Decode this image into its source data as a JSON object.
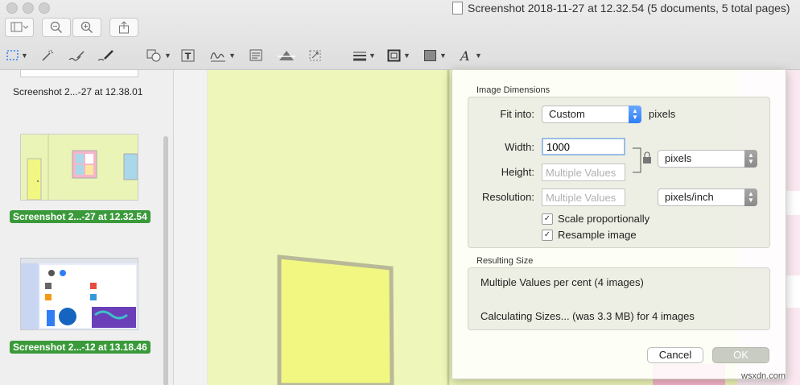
{
  "window": {
    "title": "Screenshot 2018-11-27 at 12.32.54 (5 documents, 5 total pages)"
  },
  "toolbar": {
    "sidebar_icon": "sidebar-toggle-icon",
    "zoom_out_icon": "zoom-out-icon",
    "zoom_in_icon": "zoom-in-icon",
    "share_icon": "share-icon"
  },
  "markup_tools": [
    "rect-select-icon",
    "instant-alpha-icon",
    "sketch-icon",
    "draw-icon",
    "shapes-icon",
    "text-icon",
    "sign-icon",
    "note-icon",
    "adjust-color-icon",
    "adjust-size-icon",
    "line-style-icon",
    "border-color-icon",
    "fill-color-icon",
    "text-style-icon"
  ],
  "sidebar": {
    "items": [
      {
        "label": "Screenshot 2...-27 at 12.38.01",
        "selected": false
      },
      {
        "label": "Screenshot 2...-27 at 12.32.54",
        "selected": true
      },
      {
        "label": "Screenshot 2...-12 at 13.18.46",
        "selected": true
      }
    ]
  },
  "dialog": {
    "image_dimensions_label": "Image Dimensions",
    "fit_into_label": "Fit into:",
    "fit_into_value": "Custom",
    "fit_into_unit": "pixels",
    "width_label": "Width:",
    "width_value": "1000",
    "height_label": "Height:",
    "height_placeholder": "Multiple Values",
    "resolution_label": "Resolution:",
    "resolution_placeholder": "Multiple Values",
    "size_unit": "pixels",
    "resolution_unit": "pixels/inch",
    "scale_label": "Scale proportionally",
    "scale_checked": true,
    "resample_label": "Resample image",
    "resample_checked": true,
    "resulting_size_label": "Resulting Size",
    "result_line1": "Multiple Values per cent (4 images)",
    "result_line2": "Calculating Sizes... (was 3.3 MB) for 4 images",
    "cancel_label": "Cancel",
    "ok_label": "OK"
  },
  "watermark": "wsxdn.com",
  "colors": {
    "selection_green": "#3a9a3a",
    "canvas_yellow": "#eaf4b6",
    "door_yellow": "#f2f781",
    "accent_blue": "#2f7ef6"
  }
}
